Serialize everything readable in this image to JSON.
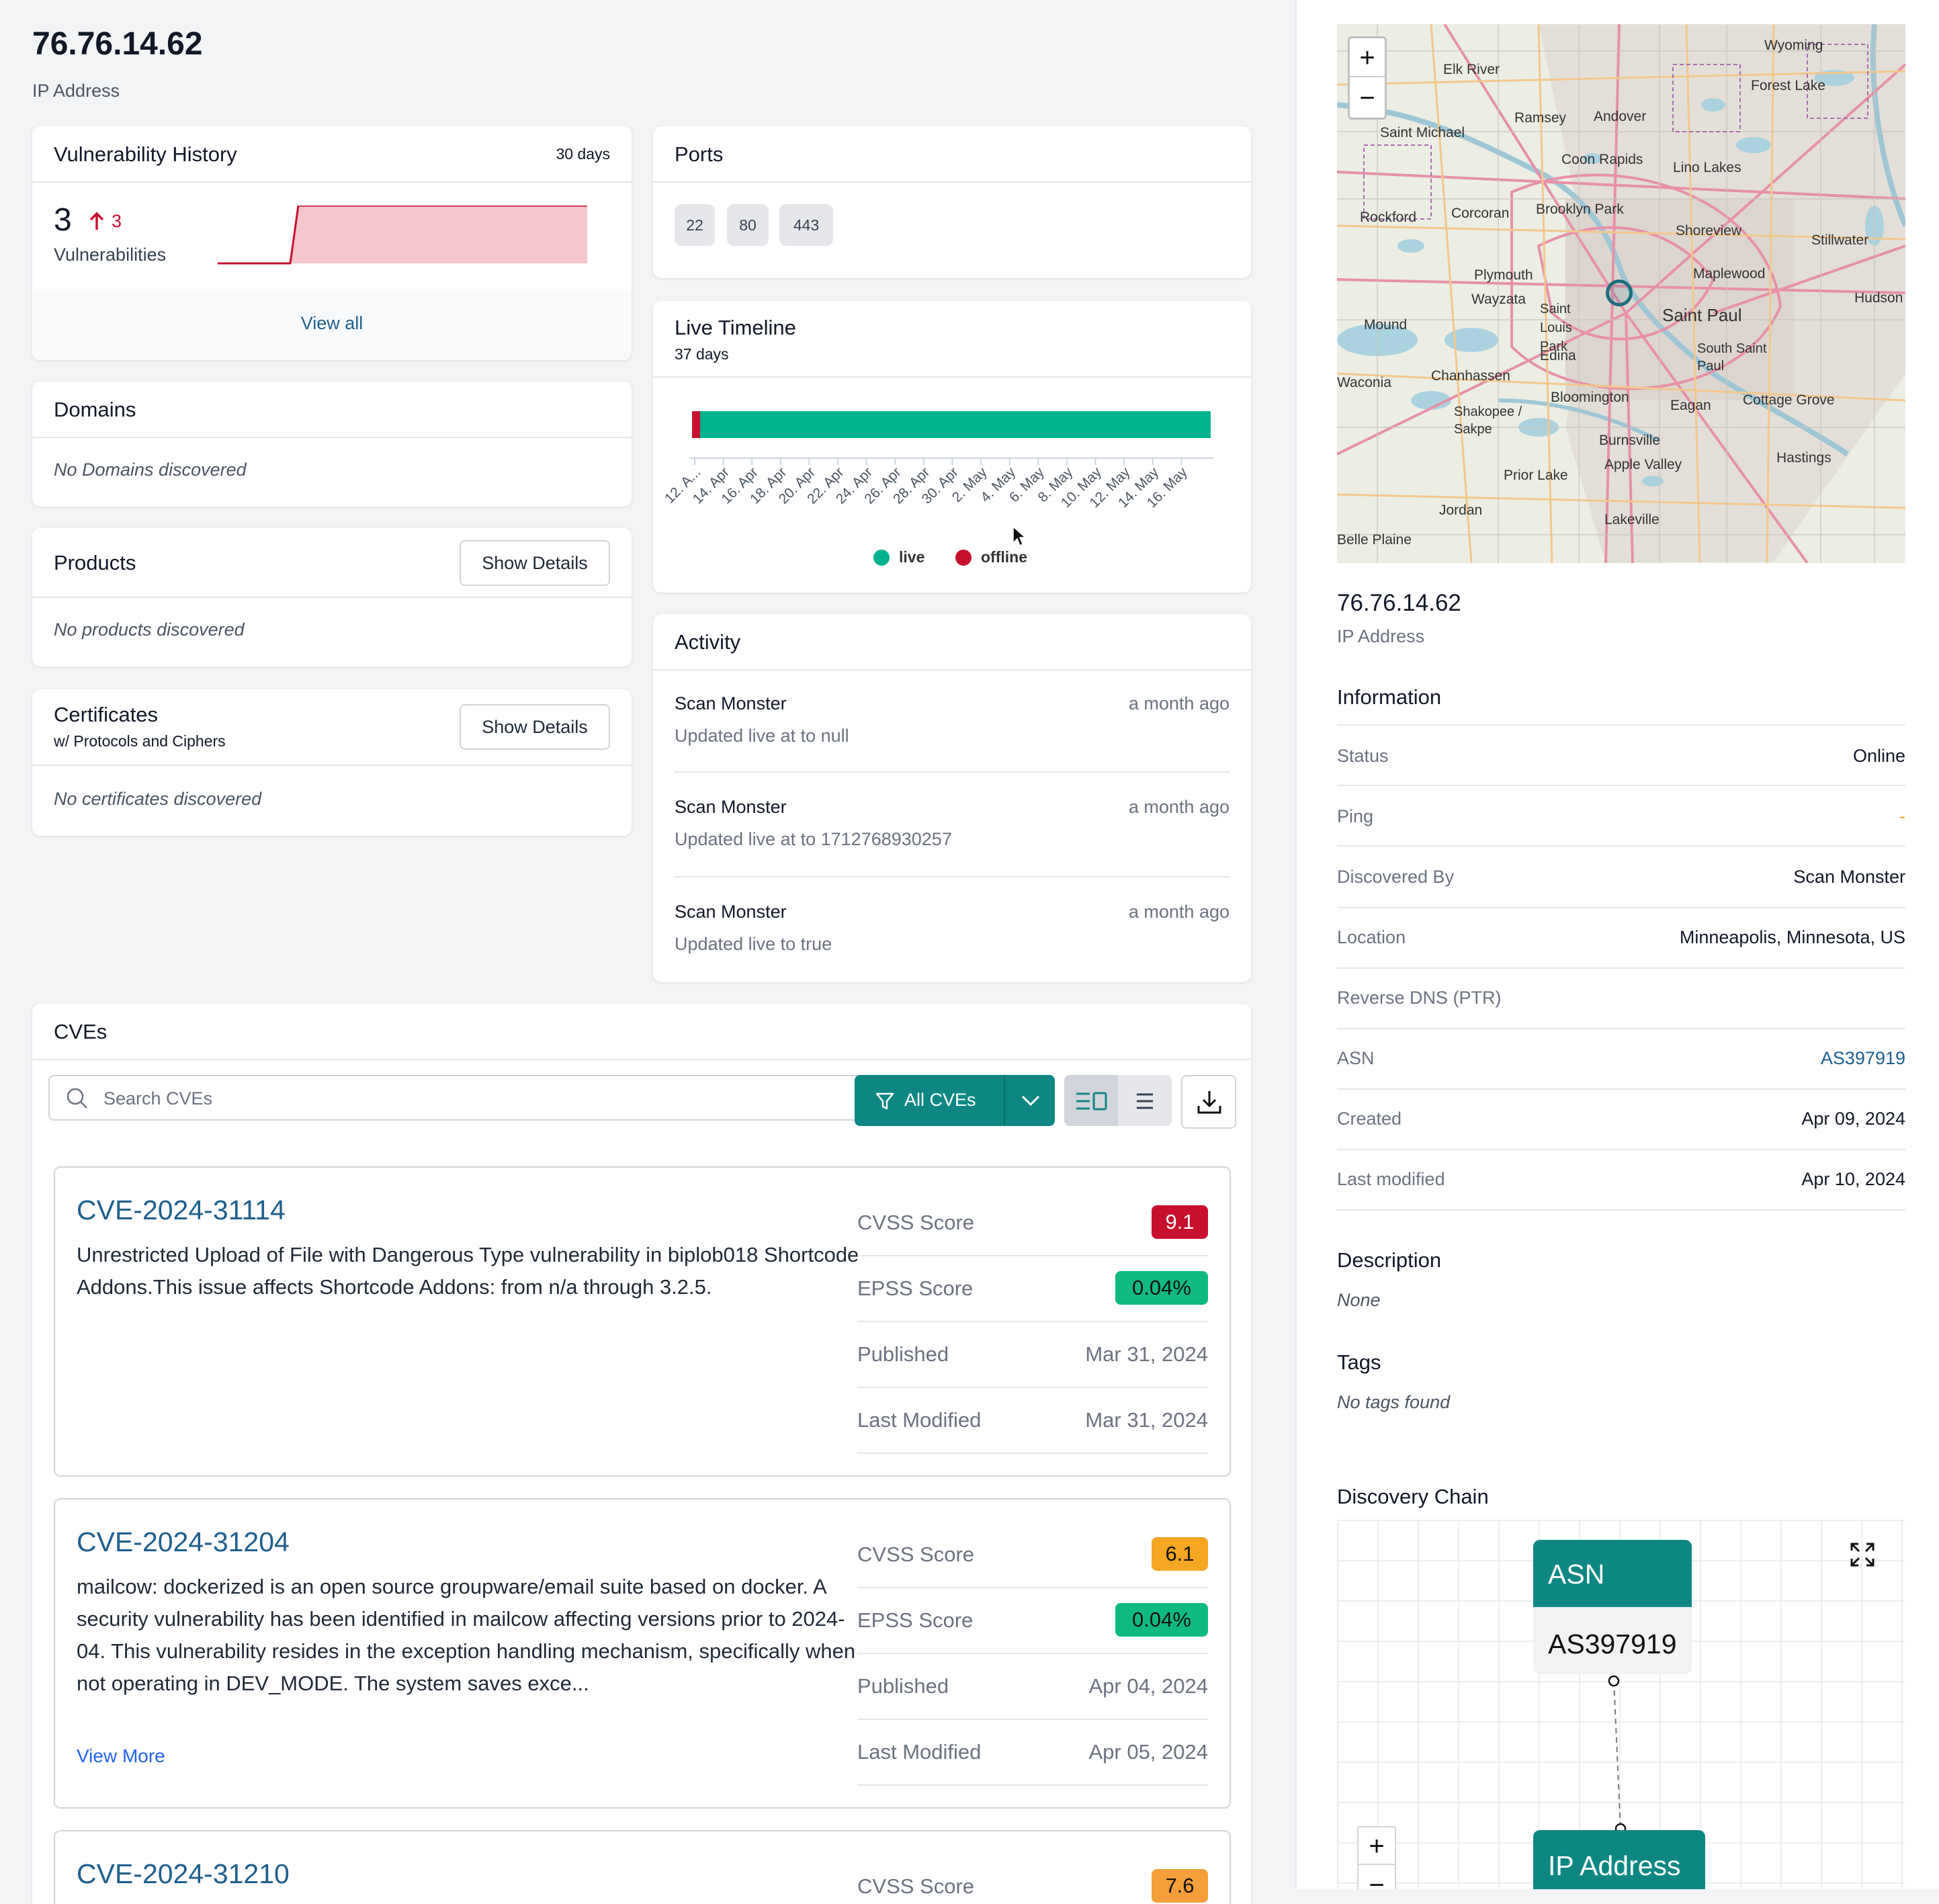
{
  "header": {
    "ip": "76.76.14.62",
    "subtitle": "IP Address"
  },
  "vuln_history": {
    "title": "Vulnerability History",
    "range": "30 days",
    "count": "3",
    "delta": "3",
    "label": "Vulnerabilities",
    "view_all": "View all",
    "colors": {
      "line": "#c8102e",
      "fill": "#f5c6cb"
    }
  },
  "domains": {
    "title": "Domains",
    "empty": "No Domains discovered"
  },
  "products": {
    "title": "Products",
    "button": "Show Details",
    "empty": "No products discovered"
  },
  "certificates": {
    "title": "Certificates",
    "subtitle": "w/ Protocols and Ciphers",
    "button": "Show Details",
    "empty": "No certificates discovered"
  },
  "ports": {
    "title": "Ports",
    "items": [
      "22",
      "80",
      "443"
    ]
  },
  "live_timeline": {
    "title": "Live Timeline",
    "subtitle": "37 days",
    "legend_live": "live",
    "legend_offline": "offline",
    "ticks": [
      "12. A...",
      "14. Apr",
      "16. Apr",
      "18. Apr",
      "20. Apr",
      "22. Apr",
      "24. Apr",
      "26. Apr",
      "28. Apr",
      "30. Apr",
      "2. May",
      "4. May",
      "6. May",
      "8. May",
      "10. May",
      "12. May",
      "14. May",
      "16. May"
    ],
    "colors": {
      "live": "#00b38f",
      "offline": "#c8102e"
    }
  },
  "activity": {
    "title": "Activity",
    "items": [
      {
        "name": "Scan Monster",
        "time": "a month ago",
        "desc": "Updated live at to null"
      },
      {
        "name": "Scan Monster",
        "time": "a month ago",
        "desc": "Updated live at to 1712768930257"
      },
      {
        "name": "Scan Monster",
        "time": "a month ago",
        "desc": "Updated live to true"
      }
    ]
  },
  "cves": {
    "title": "CVEs",
    "search_placeholder": "Search CVEs",
    "filter_label": "All CVEs",
    "labels": {
      "cvss": "CVSS Score",
      "epss": "EPSS Score",
      "published": "Published",
      "modified": "Last Modified"
    },
    "view_more": "View More",
    "items": [
      {
        "id": "CVE-2024-31114",
        "desc": "Unrestricted Upload of File with Dangerous Type vulnerability in biplob018 Shortcode Addons.This issue affects Shortcode Addons: from n/a through 3.2.5.",
        "cvss": "9.1",
        "epss": "0.04%",
        "published": "Mar 31, 2024",
        "modified": "Mar 31, 2024"
      },
      {
        "id": "CVE-2024-31204",
        "desc": "mailcow: dockerized is an open source groupware/email suite based on docker. A security vulnerability has been identified in mailcow affecting versions prior to 2024-04. This vulnerability resides in the exception handling mechanism, specifically when not operating in DEV_MODE. The system saves exce...",
        "cvss": "6.1",
        "epss": "0.04%",
        "published": "Apr 04, 2024",
        "modified": "Apr 05, 2024"
      },
      {
        "id": "CVE-2024-31210",
        "cvss": "7.6"
      }
    ],
    "colors": {
      "critical": "#c8102e",
      "medium": "#f5a623",
      "high": "#f59f3a",
      "epss": "#10b981",
      "brand": "#0e8784"
    }
  },
  "map": {
    "zoom_in": "+",
    "zoom_out": "−",
    "places": [
      "Elk River",
      "Wyoming",
      "Forest Lake",
      "Ramsey",
      "Andover",
      "Saint Michael",
      "Coon Rapids",
      "Lino Lakes",
      "Rockford",
      "Corcoran",
      "Brooklyn Park",
      "Shoreview",
      "Stillwater",
      "Plymouth",
      "Maplewood",
      "Wayzata",
      "Saint Louis Park",
      "Saint Paul",
      "Hudson",
      "Mound",
      "Edina",
      "South Saint Paul",
      "Waconia",
      "Chanhassen",
      "Bloomington",
      "Cottage Grove",
      "Shakopee / Sakpe",
      "Eagan",
      "Burnsville",
      "Hastings",
      "Prior Lake",
      "Apple Valley",
      "Jordan",
      "Lakeville",
      "Belle Plaine"
    ]
  },
  "sidebar": {
    "ip": "76.76.14.62",
    "subtitle": "IP Address",
    "info_title": "Information",
    "info": [
      {
        "label": "Status",
        "value": "Online"
      },
      {
        "label": "Ping",
        "value": "-"
      },
      {
        "label": "Discovered By",
        "value": "Scan Monster"
      },
      {
        "label": "Location",
        "value": "Minneapolis, Minnesota, US"
      },
      {
        "label": "Reverse DNS (PTR)",
        "value": ""
      },
      {
        "label": "ASN",
        "value": "AS397919"
      },
      {
        "label": "Created",
        "value": "Apr 09, 2024"
      },
      {
        "label": "Last modified",
        "value": "Apr 10, 2024"
      }
    ],
    "description_title": "Description",
    "description": "None",
    "tags_title": "Tags",
    "tags_empty": "No tags found",
    "chain_title": "Discovery Chain",
    "chain": [
      {
        "type": "ASN",
        "value": "AS397919"
      },
      {
        "type": "IP Address",
        "value": ""
      }
    ],
    "chain_zoom_in": "+",
    "chain_zoom_out": "−"
  }
}
